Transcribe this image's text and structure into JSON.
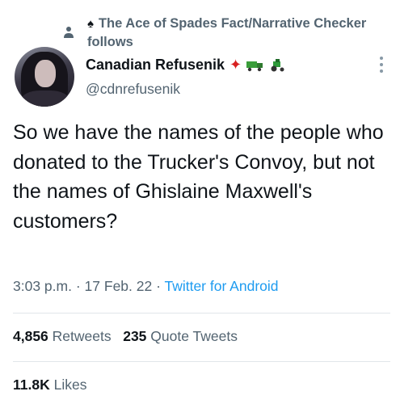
{
  "social_context": {
    "account": "The Ace of Spades Fact/Narrative Checker",
    "action": "follows"
  },
  "author": {
    "display_name": "Canadian Refusenik",
    "handle": "@cdnrefusenik",
    "name_emojis": [
      "maple-leaf",
      "truck",
      "tractor"
    ]
  },
  "tweet": {
    "text": "So we have the names of the people who donated to the Trucker's Convoy, but not the names of Ghislaine Maxwell's customers?",
    "time": "3:03 p.m.",
    "date": "17 Feb. 22",
    "source": "Twitter for Android"
  },
  "stats": {
    "retweets_count": "4,856",
    "retweets_label": "Retweets",
    "quote_tweets_count": "235",
    "quote_tweets_label": "Quote Tweets",
    "likes_count": "11.8K",
    "likes_label": "Likes"
  },
  "colors": {
    "secondary_text": "#536471",
    "link": "#1d9bf0",
    "divider": "#e1e6ea"
  }
}
